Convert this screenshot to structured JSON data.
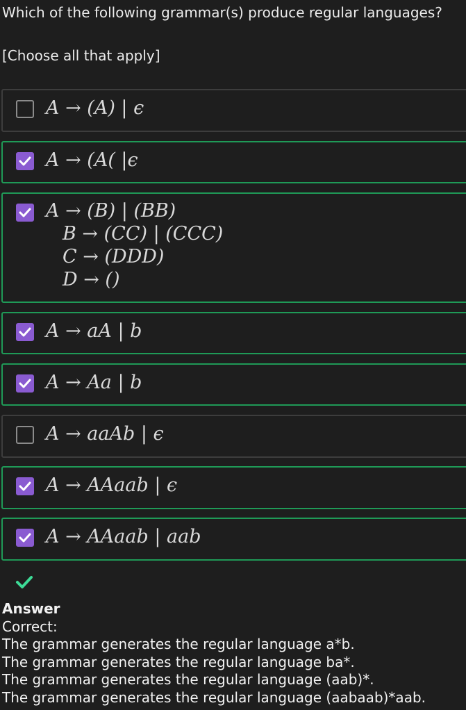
{
  "question": {
    "text": "Which of the following grammar(s) produce regular languages?",
    "instruction": "[Choose all that apply]"
  },
  "options": [
    {
      "checked": false,
      "lines": [
        "A → (A) | ϵ"
      ]
    },
    {
      "checked": true,
      "lines": [
        "A → (A( |ϵ"
      ]
    },
    {
      "checked": true,
      "lines": [
        "A → (B) | (BB)",
        "B → (CC) | (CCC)",
        "C → (DDD)",
        "D → ()"
      ]
    },
    {
      "checked": true,
      "lines": [
        "A → aA | b"
      ]
    },
    {
      "checked": true,
      "lines": [
        "A → Aa | b"
      ]
    },
    {
      "checked": false,
      "lines": [
        "A → aaAb | ϵ"
      ]
    },
    {
      "checked": true,
      "lines": [
        "A → AAaab | ϵ"
      ]
    },
    {
      "checked": true,
      "lines": [
        "A → AAaab | aab"
      ]
    }
  ],
  "result": {
    "icon": "check-icon",
    "color": "#3ddc97"
  },
  "answer": {
    "heading": "Answer",
    "status": "Correct:",
    "lines": [
      "The grammar generates the regular language a*b.",
      "The grammar generates the regular language ba*.",
      "The grammar generates the regular language (aab)*.",
      "The grammar generates the regular language (aabaab)*aab."
    ]
  },
  "colors": {
    "checked_border": "#1f9a57",
    "unchecked_border": "#3d3d3d",
    "checkbox_fill": "#8a5bd1",
    "background": "#1e1e1e"
  }
}
